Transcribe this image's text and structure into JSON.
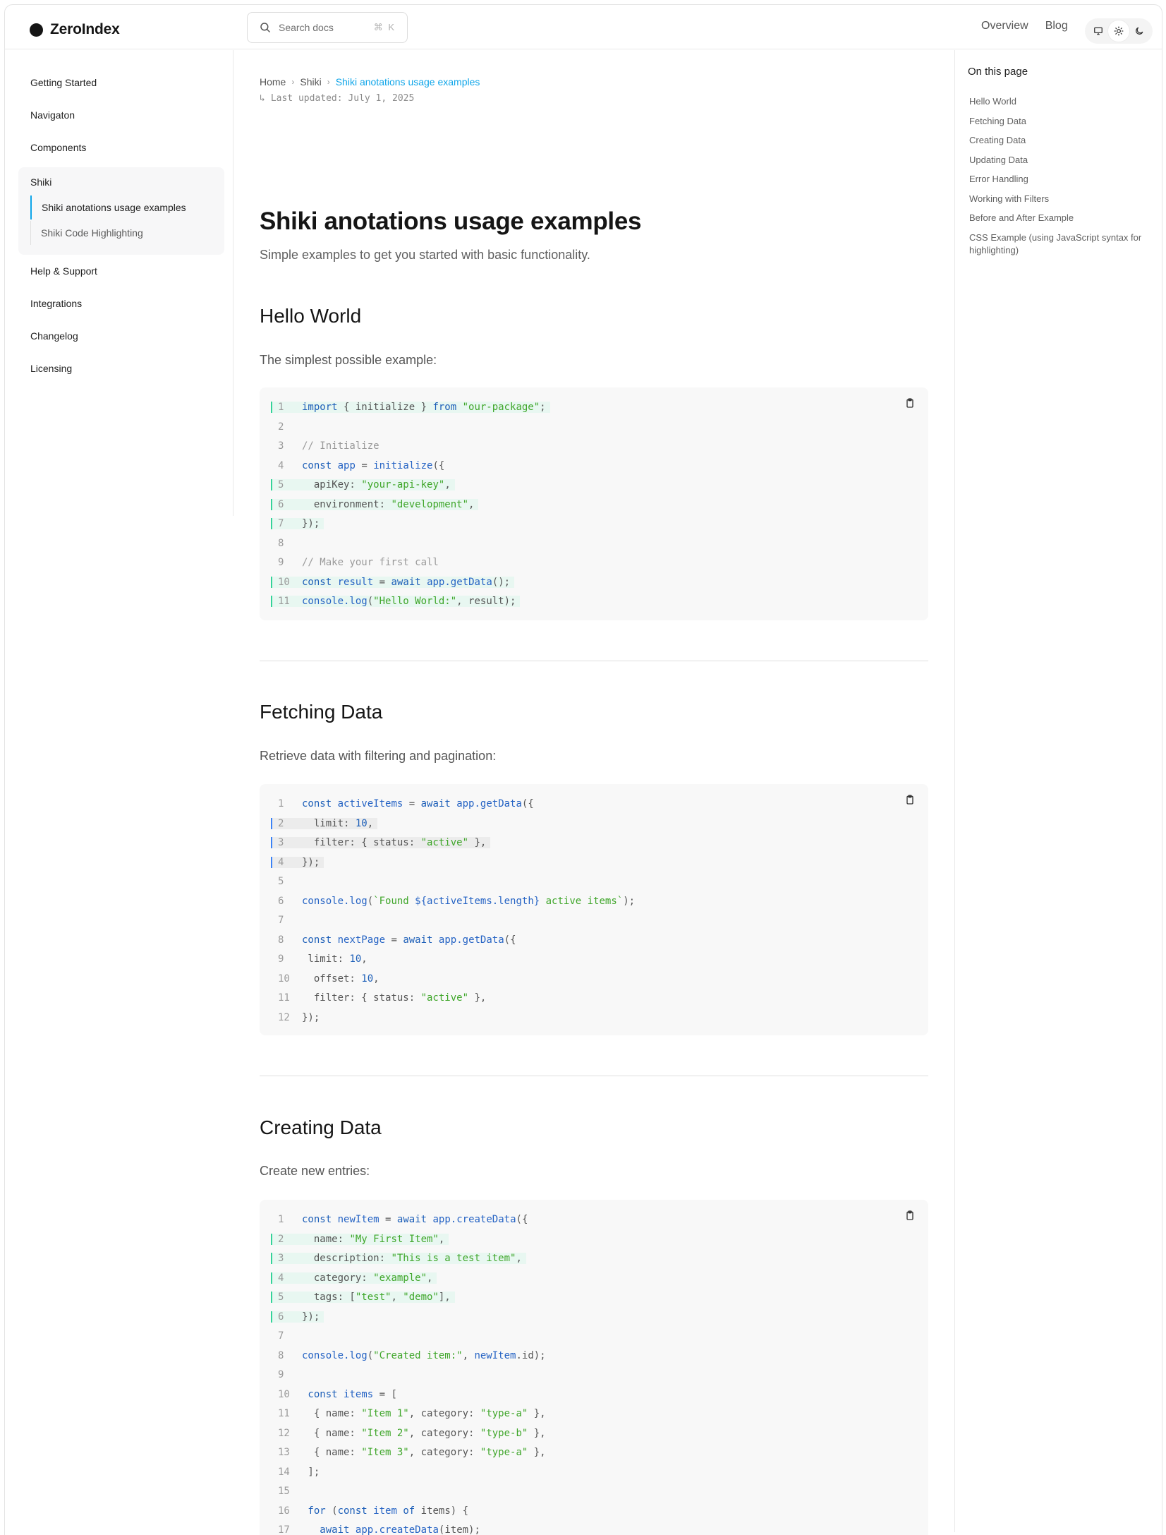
{
  "app": {
    "name": "ZeroIndex"
  },
  "search": {
    "placeholder": "Search docs",
    "shortcut": "⌘ K"
  },
  "header": {
    "links": [
      "Overview",
      "Blog"
    ]
  },
  "theme": {
    "icons": [
      "monitor-icon",
      "sun-icon",
      "moon-icon"
    ],
    "active": "sun-icon"
  },
  "sidebar": {
    "items": [
      "Getting Started",
      "Navigaton",
      "Components"
    ],
    "group": {
      "title": "Shiki",
      "children": [
        "Shiki anotations usage examples",
        "Shiki Code Highlighting"
      ]
    },
    "items_after": [
      "Help & Support",
      "Integrations",
      "Changelog",
      "Licensing"
    ]
  },
  "breadcrumb": [
    "Home",
    "Shiki",
    "Shiki anotations usage examples"
  ],
  "updated": {
    "arrow": "↳",
    "text": "Last updated: July 1, 2025"
  },
  "page": {
    "title": "Shiki anotations usage examples",
    "subtitle": "Simple examples to get you started with basic functionality."
  },
  "sections": [
    {
      "title": "Hello World",
      "lead": "The simplest possible example:"
    },
    {
      "title": "Fetching Data",
      "lead": "Retrieve data with filtering and pagination:"
    },
    {
      "title": "Creating Data",
      "lead": "Create new entries:"
    }
  ],
  "code_blocks": [
    [
      {
        "n": "1",
        "hl": true,
        "t": [
          [
            "kw",
            "import"
          ],
          [
            "pl",
            " { initialize } "
          ],
          [
            "kw",
            "from"
          ],
          [
            "pl",
            " "
          ],
          [
            "str",
            "\"our-package\""
          ],
          [
            "pl",
            ";"
          ]
        ]
      },
      {
        "n": "2",
        "t": []
      },
      {
        "n": "3",
        "t": [
          [
            "cm",
            "// Initialize"
          ]
        ]
      },
      {
        "n": "4",
        "t": [
          [
            "kw",
            "const"
          ],
          [
            "pl",
            " "
          ],
          [
            "fn",
            "app"
          ],
          [
            "pl",
            " = "
          ],
          [
            "fn",
            "initialize"
          ],
          [
            "pl",
            "({"
          ]
        ]
      },
      {
        "n": "5",
        "hl": true,
        "t": [
          [
            "pl",
            "  apiKey: "
          ],
          [
            "str",
            "\"your-api-key\""
          ],
          [
            "pl",
            ","
          ]
        ]
      },
      {
        "n": "6",
        "hl": true,
        "t": [
          [
            "pl",
            "  environment: "
          ],
          [
            "str",
            "\"development\""
          ],
          [
            "pl",
            ","
          ]
        ]
      },
      {
        "n": "7",
        "hl": true,
        "t": [
          [
            "pl",
            "});"
          ]
        ]
      },
      {
        "n": "8",
        "t": []
      },
      {
        "n": "9",
        "t": [
          [
            "cm",
            "// Make your first call"
          ]
        ]
      },
      {
        "n": "10",
        "hl": true,
        "t": [
          [
            "kw",
            "const"
          ],
          [
            "pl",
            " "
          ],
          [
            "fn",
            "result"
          ],
          [
            "pl",
            " = "
          ],
          [
            "kw",
            "await"
          ],
          [
            "pl",
            " "
          ],
          [
            "fn",
            "app.getData"
          ],
          [
            "pl",
            "();"
          ]
        ]
      },
      {
        "n": "11",
        "hl": true,
        "t": [
          [
            "fn",
            "console.log"
          ],
          [
            "pl",
            "("
          ],
          [
            "str",
            "\"Hello World:\""
          ],
          [
            "pl",
            ", result);"
          ]
        ]
      }
    ],
    [
      {
        "n": "1",
        "t": [
          [
            "kw",
            "const"
          ],
          [
            "pl",
            " "
          ],
          [
            "fn",
            "activeItems"
          ],
          [
            "pl",
            " = "
          ],
          [
            "kw",
            "await"
          ],
          [
            "pl",
            " "
          ],
          [
            "fn",
            "app.getData"
          ],
          [
            "pl",
            "({"
          ]
        ]
      },
      {
        "n": "2",
        "fo": true,
        "t": [
          [
            "pl",
            "  limit: "
          ],
          [
            "num",
            "10"
          ],
          [
            "pl",
            ","
          ]
        ]
      },
      {
        "n": "3",
        "fo": true,
        "t": [
          [
            "pl",
            "  filter: { status: "
          ],
          [
            "str",
            "\"active\""
          ],
          [
            "pl",
            " },"
          ]
        ]
      },
      {
        "n": "4",
        "fo": true,
        "t": [
          [
            "pl",
            "});"
          ]
        ]
      },
      {
        "n": "5",
        "t": []
      },
      {
        "n": "6",
        "t": [
          [
            "fn",
            "console.log"
          ],
          [
            "pl",
            "("
          ],
          [
            "str",
            "`Found "
          ],
          [
            "fn",
            "${activeItems.length}"
          ],
          [
            "str",
            " active items`"
          ],
          [
            "pl",
            ");"
          ]
        ]
      },
      {
        "n": "7",
        "t": []
      },
      {
        "n": "8",
        "t": [
          [
            "kw",
            "const"
          ],
          [
            "pl",
            " "
          ],
          [
            "fn",
            "nextPage"
          ],
          [
            "pl",
            " = "
          ],
          [
            "kw",
            "await"
          ],
          [
            "pl",
            " "
          ],
          [
            "fn",
            "app.getData"
          ],
          [
            "pl",
            "({"
          ]
        ]
      },
      {
        "n": "9",
        "t": [
          [
            "pl",
            " limit: "
          ],
          [
            "num",
            "10"
          ],
          [
            "pl",
            ","
          ]
        ]
      },
      {
        "n": "10",
        "t": [
          [
            "pl",
            "  offset: "
          ],
          [
            "num",
            "10"
          ],
          [
            "pl",
            ","
          ]
        ]
      },
      {
        "n": "11",
        "t": [
          [
            "pl",
            "  filter: { status: "
          ],
          [
            "str",
            "\"active\""
          ],
          [
            "pl",
            " },"
          ]
        ]
      },
      {
        "n": "12",
        "t": [
          [
            "pl",
            "});"
          ]
        ]
      }
    ],
    [
      {
        "n": "1",
        "t": [
          [
            "kw",
            "const"
          ],
          [
            "pl",
            " "
          ],
          [
            "fn",
            "newItem"
          ],
          [
            "pl",
            " = "
          ],
          [
            "kw",
            "await"
          ],
          [
            "pl",
            " "
          ],
          [
            "fn",
            "app.createData"
          ],
          [
            "pl",
            "({"
          ]
        ]
      },
      {
        "n": "2",
        "hl": true,
        "t": [
          [
            "pl",
            "  name: "
          ],
          [
            "str",
            "\"My First Item\""
          ],
          [
            "pl",
            ","
          ]
        ]
      },
      {
        "n": "3",
        "hl": true,
        "t": [
          [
            "pl",
            "  description: "
          ],
          [
            "str",
            "\"This is a test item\""
          ],
          [
            "pl",
            ","
          ]
        ]
      },
      {
        "n": "4",
        "hl": true,
        "t": [
          [
            "pl",
            "  category: "
          ],
          [
            "str",
            "\"example\""
          ],
          [
            "pl",
            ","
          ]
        ]
      },
      {
        "n": "5",
        "hl": true,
        "t": [
          [
            "pl",
            "  tags: ["
          ],
          [
            "str",
            "\"test\""
          ],
          [
            "pl",
            ", "
          ],
          [
            "str",
            "\"demo\""
          ],
          [
            "pl",
            "],"
          ]
        ]
      },
      {
        "n": "6",
        "hl": true,
        "t": [
          [
            "pl",
            "});"
          ]
        ]
      },
      {
        "n": "7",
        "t": []
      },
      {
        "n": "8",
        "t": [
          [
            "fn",
            "console.log"
          ],
          [
            "pl",
            "("
          ],
          [
            "str",
            "\"Created item:\""
          ],
          [
            "pl",
            ", "
          ],
          [
            "fn",
            "newItem"
          ],
          [
            "pl",
            ".id);"
          ]
        ]
      },
      {
        "n": "9",
        "t": []
      },
      {
        "n": "10",
        "t": [
          [
            "kw",
            " const"
          ],
          [
            "pl",
            " "
          ],
          [
            "fn",
            "items"
          ],
          [
            "pl",
            " = ["
          ]
        ]
      },
      {
        "n": "11",
        "t": [
          [
            "pl",
            "  { name: "
          ],
          [
            "str",
            "\"Item 1\""
          ],
          [
            "pl",
            ", category: "
          ],
          [
            "str",
            "\"type-a\""
          ],
          [
            "pl",
            " },"
          ]
        ]
      },
      {
        "n": "12",
        "t": [
          [
            "pl",
            "  { name: "
          ],
          [
            "str",
            "\"Item 2\""
          ],
          [
            "pl",
            ", category: "
          ],
          [
            "str",
            "\"type-b\""
          ],
          [
            "pl",
            " },"
          ]
        ]
      },
      {
        "n": "13",
        "t": [
          [
            "pl",
            "  { name: "
          ],
          [
            "str",
            "\"Item 3\""
          ],
          [
            "pl",
            ", category: "
          ],
          [
            "str",
            "\"type-a\""
          ],
          [
            "pl",
            " },"
          ]
        ]
      },
      {
        "n": "14",
        "t": [
          [
            "pl",
            " ];"
          ]
        ]
      },
      {
        "n": "15",
        "t": []
      },
      {
        "n": "16",
        "t": [
          [
            "kw",
            " for"
          ],
          [
            "pl",
            " ("
          ],
          [
            "kw",
            "const"
          ],
          [
            "pl",
            " "
          ],
          [
            "fn",
            "item"
          ],
          [
            "pl",
            " "
          ],
          [
            "kw",
            "of"
          ],
          [
            "pl",
            " items) {"
          ]
        ]
      },
      {
        "n": "17",
        "t": [
          [
            "pl",
            "   "
          ],
          [
            "kw",
            "await"
          ],
          [
            "pl",
            " "
          ],
          [
            "fn",
            "app.createData"
          ],
          [
            "pl",
            "(item);"
          ]
        ]
      }
    ]
  ],
  "toc": {
    "title": "On this page",
    "items": [
      "Hello World",
      "Fetching Data",
      "Creating Data",
      "Updating Data",
      "Error Handling",
      "Working with Filters",
      "Before and After Example",
      "CSS Example (using JavaScript syntax for highlighting)"
    ]
  }
}
